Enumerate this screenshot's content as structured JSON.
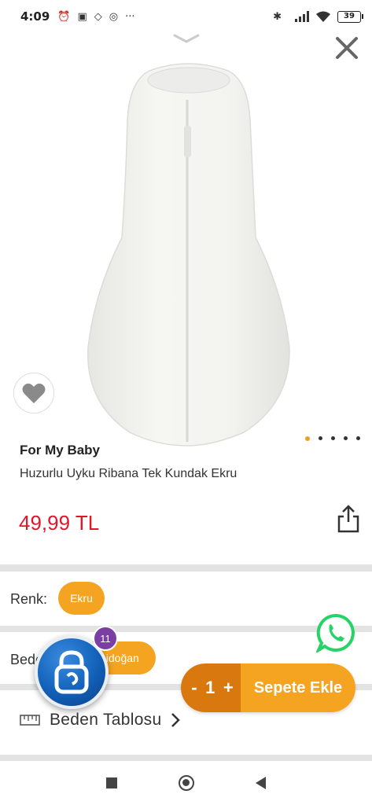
{
  "status_bar": {
    "time": "4:09",
    "battery": "39",
    "icons": [
      "alarm-icon",
      "calendar-icon",
      "signal-app-icon",
      "instagram-icon",
      "more-icon",
      "bluetooth-icon",
      "cell-signal-icon",
      "wifi-icon",
      "battery-icon"
    ],
    "more": "···"
  },
  "product": {
    "brand": "For My Baby",
    "title": "Huzurlu Uyku Ribana Tek Kundak Ekru",
    "price": "49,99 TL",
    "image_count": 5,
    "active_image_index": 0
  },
  "options": {
    "color_label": "Renk:",
    "color_value": "Ekru",
    "size_label": "Beden:",
    "size_value": "Yenidoğan",
    "size_table_label": "Beden Tablosu"
  },
  "cart": {
    "minus": "-",
    "quantity": "1",
    "plus": "+",
    "add_label": "Sepete Ekle"
  },
  "floating_app": {
    "badge_count": "11"
  },
  "colors": {
    "accent": "#f4a420",
    "accent_dark": "#d9780f",
    "price": "#e0172c",
    "whatsapp": "#25d366"
  }
}
